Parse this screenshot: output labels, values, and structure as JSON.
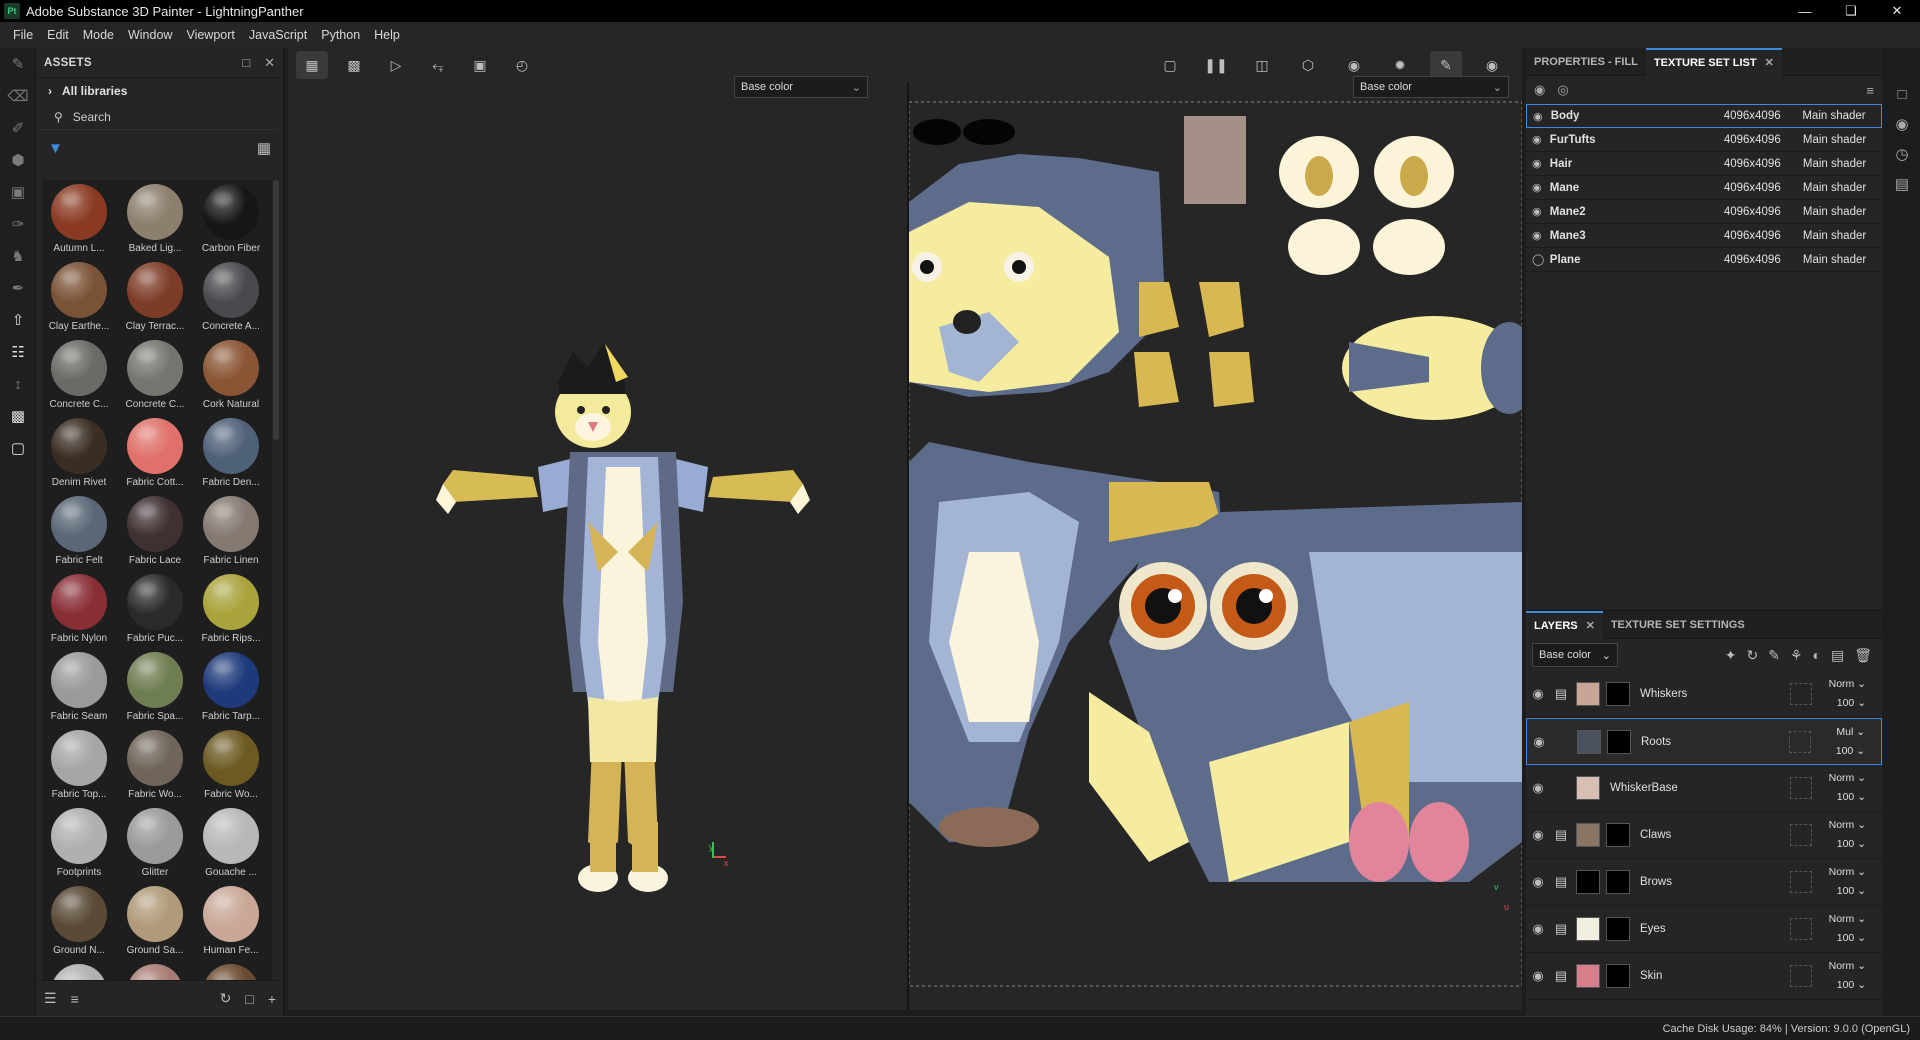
{
  "window": {
    "title": "Adobe Substance 3D Painter - LightningPanther",
    "logo": "Pt"
  },
  "menu": [
    "File",
    "Edit",
    "Mode",
    "Window",
    "Viewport",
    "JavaScript",
    "Python",
    "Help"
  ],
  "assets": {
    "title": "ASSETS",
    "all_libraries": "All libraries",
    "search_placeholder": "Search",
    "items": [
      {
        "label": "Autumn L...",
        "color": "#8a3a22"
      },
      {
        "label": "Baked Lig...",
        "color": "#8c7f6d"
      },
      {
        "label": "Carbon Fiber",
        "color": "#161616"
      },
      {
        "label": "Clay Earthe...",
        "color": "#7a5236"
      },
      {
        "label": "Clay Terrac...",
        "color": "#7d3c28"
      },
      {
        "label": "Concrete A...",
        "color": "#4a4a4e"
      },
      {
        "label": "Concrete C...",
        "color": "#6c6a66"
      },
      {
        "label": "Concrete C...",
        "color": "#77756f"
      },
      {
        "label": "Cork Natural",
        "color": "#8a5534"
      },
      {
        "label": "Denim Rivet",
        "color": "#3a2e24"
      },
      {
        "label": "Fabric Cott...",
        "color": "#e0716a"
      },
      {
        "label": "Fabric Den...",
        "color": "#4f6079"
      },
      {
        "label": "Fabric Felt",
        "color": "#5a6776"
      },
      {
        "label": "Fabric Lace",
        "color": "#3f3032"
      },
      {
        "label": "Fabric Linen",
        "color": "#857a72"
      },
      {
        "label": "Fabric Nylon",
        "color": "#8a2e36"
      },
      {
        "label": "Fabric Puc...",
        "color": "#2a2a2a"
      },
      {
        "label": "Fabric Rips...",
        "color": "#a9a33c"
      },
      {
        "label": "Fabric Seam",
        "color": "#9a9a9a"
      },
      {
        "label": "Fabric Spa...",
        "color": "#6f7d52"
      },
      {
        "label": "Fabric Tarp...",
        "color": "#1f3a7a"
      },
      {
        "label": "Fabric Top...",
        "color": "#a6a6a6"
      },
      {
        "label": "Fabric Wo...",
        "color": "#6f655a"
      },
      {
        "label": "Fabric Wo...",
        "color": "#6c5a22"
      },
      {
        "label": "Footprints",
        "color": "#b0b0b0"
      },
      {
        "label": "Glitter",
        "color": "#9a9a9a"
      },
      {
        "label": "Gouache ...",
        "color": "#b8b8b8"
      },
      {
        "label": "Ground N...",
        "color": "#5a4a36"
      },
      {
        "label": "Ground Sa...",
        "color": "#b09a7a"
      },
      {
        "label": "Human Fe...",
        "color": "#c9a898"
      },
      {
        "label": "",
        "color": "#b0b0b0"
      },
      {
        "label": "",
        "color": "#a87c74"
      },
      {
        "label": "",
        "color": "#6a4a30"
      }
    ]
  },
  "viewport": {
    "channel_left": "Base color",
    "channel_right": "Base color",
    "axis_x": "x",
    "axis_y": "y",
    "axis_u": "u",
    "axis_v": "v"
  },
  "right_panel": {
    "tab_properties": "PROPERTIES - FILL",
    "tab_texture_set_list": "TEXTURE SET LIST",
    "texture_sets": [
      {
        "name": "Body",
        "res": "4096x4096",
        "shader": "Main shader",
        "selected": true
      },
      {
        "name": "FurTufts",
        "res": "4096x4096",
        "shader": "Main shader"
      },
      {
        "name": "Hair",
        "res": "4096x4096",
        "shader": "Main shader"
      },
      {
        "name": "Mane",
        "res": "4096x4096",
        "shader": "Main shader"
      },
      {
        "name": "Mane2",
        "res": "4096x4096",
        "shader": "Main shader"
      },
      {
        "name": "Mane3",
        "res": "4096x4096",
        "shader": "Main shader"
      },
      {
        "name": "Plane",
        "res": "4096x4096",
        "shader": "Main shader"
      }
    ],
    "tab_layers": "LAYERS",
    "tab_texture_set_settings": "TEXTURE SET SETTINGS",
    "layers_channel": "Base color",
    "layers": [
      {
        "name": "Whiskers",
        "blend": "Norm",
        "opacity": "100",
        "folder": true,
        "thumb": "#c9a598",
        "mask": "#000"
      },
      {
        "name": "Roots",
        "blend": "Mul",
        "opacity": "100",
        "folder": false,
        "thumb": "#4a5260",
        "mask": "#000",
        "selected": true
      },
      {
        "name": "WhiskerBase",
        "blend": "Norm",
        "opacity": "100",
        "folder": false,
        "thumb": "#d7bfb4",
        "mask": ""
      },
      {
        "name": "Claws",
        "blend": "Norm",
        "opacity": "100",
        "folder": true,
        "thumb": "#8a7565",
        "mask": "#000"
      },
      {
        "name": "Brows",
        "blend": "Norm",
        "opacity": "100",
        "folder": true,
        "thumb": "#000",
        "mask": "#000"
      },
      {
        "name": "Eyes",
        "blend": "Norm",
        "opacity": "100",
        "folder": true,
        "thumb": "#f2efe0",
        "mask": "#000"
      },
      {
        "name": "Skin",
        "blend": "Norm",
        "opacity": "100",
        "folder": true,
        "thumb": "#d77f8a",
        "mask": "#000"
      }
    ]
  },
  "status": {
    "text": "Cache Disk Usage:   84% | Version: 9.0.0 (OpenGL)"
  }
}
